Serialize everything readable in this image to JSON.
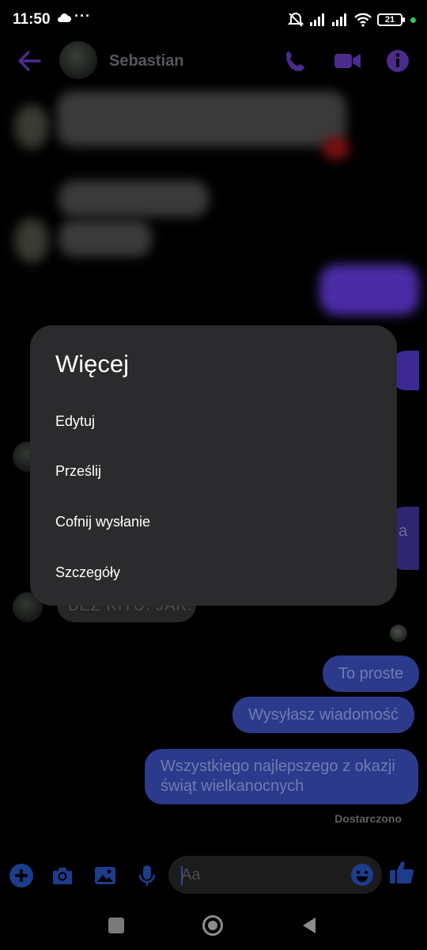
{
  "status_bar": {
    "time": "11:50",
    "overflow": "···",
    "battery_level": "21",
    "icons": [
      "cloud-icon",
      "dnd-off-icon",
      "signal-icon",
      "signal-icon",
      "wifi-icon",
      "battery-icon"
    ]
  },
  "header": {
    "contact_name": "Sebastian",
    "accent_color": "#8b4dff"
  },
  "conversation": {
    "received_partial_text": "BEZ KITU. JAK.",
    "sent_peek_text": "a",
    "messages": [
      {
        "text": "To proste"
      },
      {
        "text": "Wysyłasz wiadomość"
      },
      {
        "text": "Wszystkiego najlepszego z okazji świąt wielkanocnych"
      }
    ],
    "delivery_status": "Dostarczono"
  },
  "composer": {
    "placeholder": "Aa",
    "value": ""
  },
  "menu": {
    "title": "Więcej",
    "items": [
      {
        "label": "Edytuj"
      },
      {
        "label": "Prześlij"
      },
      {
        "label": "Cofnij wysłanie"
      },
      {
        "label": "Szczegóły"
      }
    ]
  }
}
